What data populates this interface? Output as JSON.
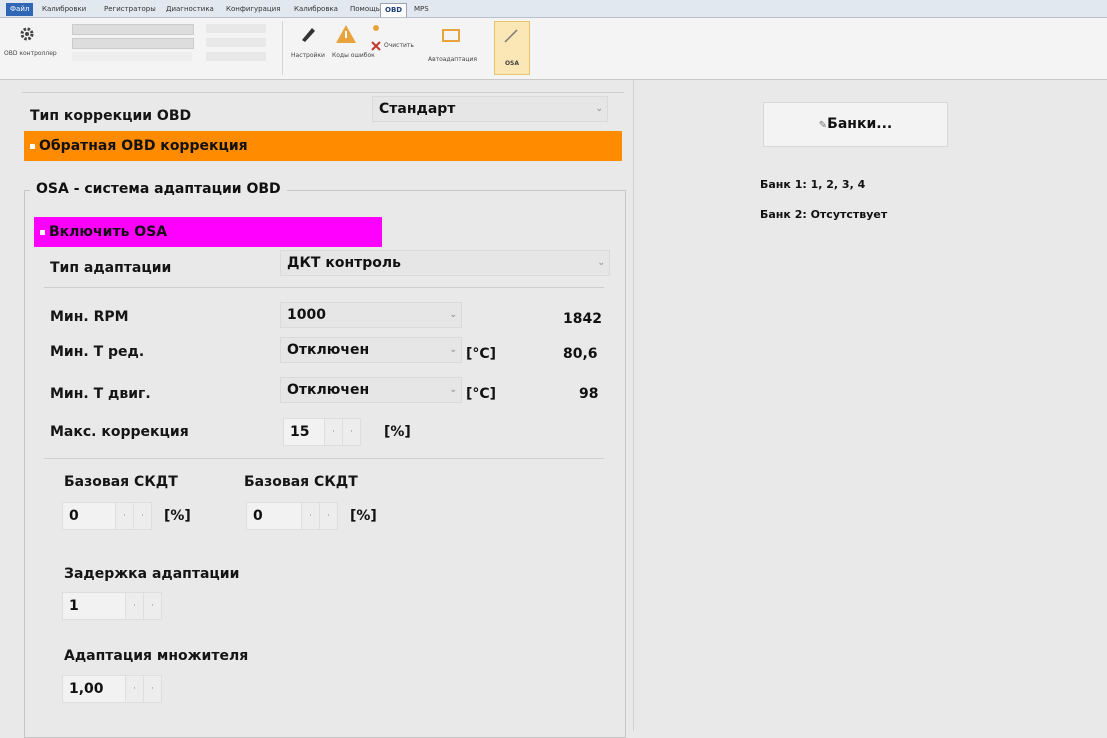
{
  "ribbon": {
    "tabs": [
      "Файл",
      "Калибровки",
      "Регистраторы",
      "Диагностика",
      "Конфигурация",
      "Калибровка",
      "Помощь",
      "OBD",
      "MPS"
    ],
    "items": {
      "obd_control_label": "OBD контроллер",
      "calib_label": "Настройки",
      "codes_label": "Коды ошибок",
      "clear_label": "Очистить",
      "readiness_label": "Автоадаптация",
      "osa_label": "OSA"
    }
  },
  "main": {
    "correction_type_label": "Тип коррекции OBD",
    "correction_type_value": "Стандарт",
    "reverse_obd_correction": "Обратная OBD коррекция",
    "osa_group_title": "OSA - система адаптации OBD",
    "enable_osa": "Включить OSA",
    "adaptation_type_label": "Тип адаптации",
    "adaptation_type_value": "ДКТ контроль",
    "min_rpm_label": "Мин. RPM",
    "min_rpm_value": "1000",
    "min_rpm_current": "1842",
    "min_t_red_label": "Мин. T ред.",
    "min_t_red_value": "Отключен",
    "min_t_red_unit": "[°C]",
    "min_t_red_current": "80,6",
    "min_t_eng_label": "Мин. T двиг.",
    "min_t_eng_value": "Отключен",
    "min_t_eng_unit": "[°C]",
    "min_t_eng_current": "98",
    "max_corr_label": "Макс. коррекция",
    "max_corr_value": "15",
    "max_corr_unit": "[%]",
    "base_skdt1_label": "Базовая СКДТ",
    "base_skdt1_value": "0",
    "base_skdt1_unit": "[%]",
    "base_skdt2_label": "Базовая СКДТ",
    "base_skdt2_value": "0",
    "base_skdt2_unit": "[%]",
    "delay_label": "Задержка адаптации",
    "delay_value": "1",
    "mult_label": "Адаптация множителя",
    "mult_value": "1,00"
  },
  "right": {
    "banks_button": "Банки...",
    "bank1": "Банк 1:  1, 2, 3, 4",
    "bank2": "Банк 2:  Отсутствует"
  },
  "colors": {
    "orange": "#ff8c00",
    "magenta": "#ff00ff",
    "ribbon_blue": "#2f66b5",
    "active_tab": "#1c3f77"
  }
}
